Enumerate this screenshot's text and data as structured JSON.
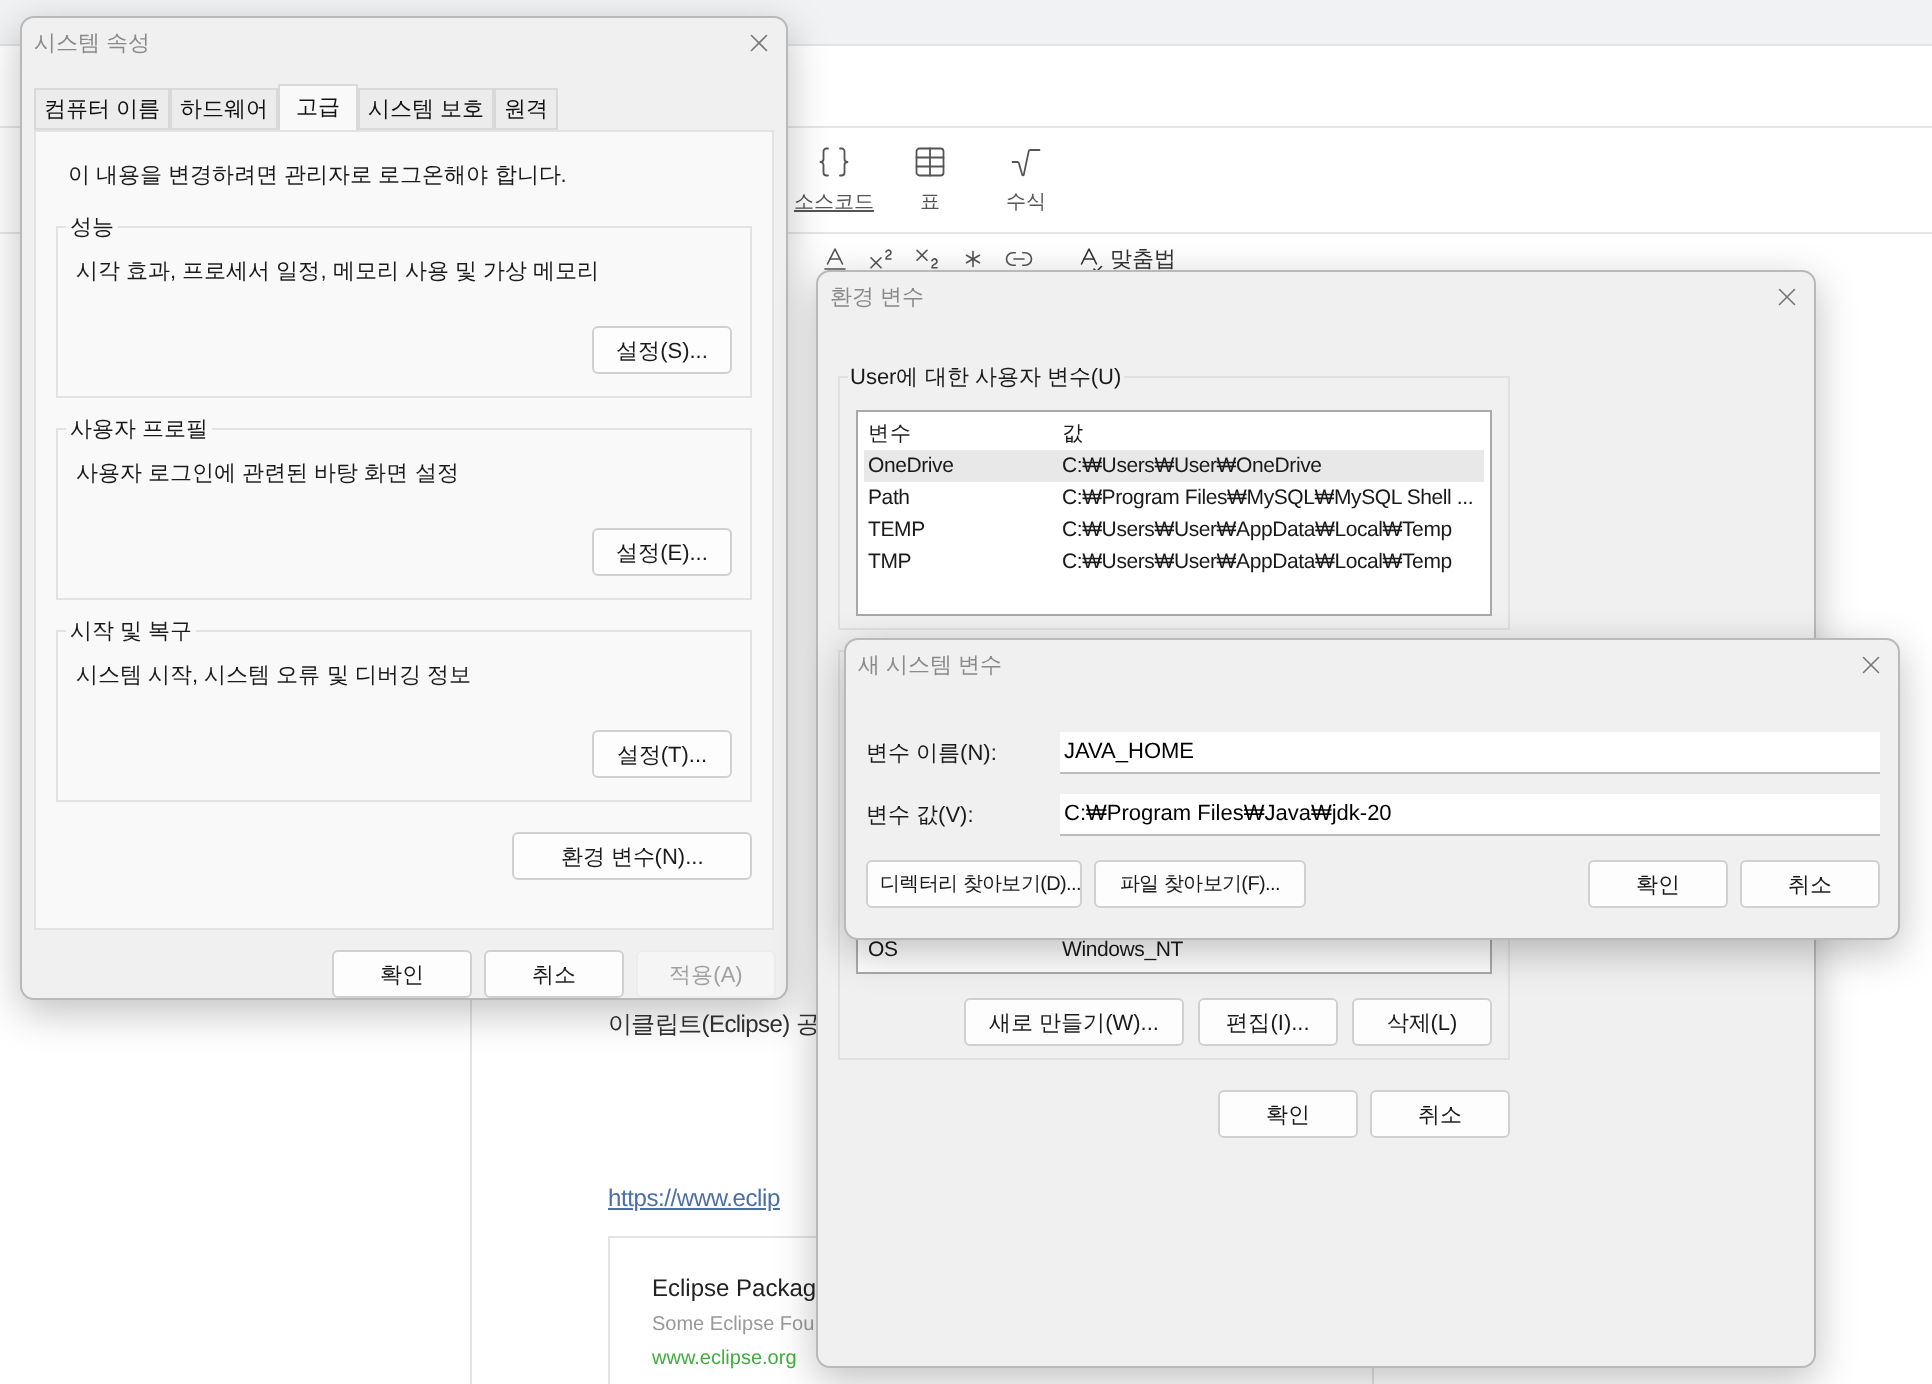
{
  "browser": {
    "insert_tools": [
      {
        "kind": "code",
        "label": "소스코드",
        "underlined": true
      },
      {
        "kind": "table",
        "label": "표",
        "underlined": false
      },
      {
        "kind": "formula",
        "label": "수식",
        "underlined": false
      }
    ],
    "format_tools": [
      {
        "kind": "text-style"
      },
      {
        "kind": "superscript"
      },
      {
        "kind": "subscript"
      },
      {
        "kind": "symbol"
      },
      {
        "kind": "link"
      },
      {
        "kind": "spellcheck",
        "label": "맞춤법"
      }
    ],
    "article": {
      "paragraph": "이클립트(Eclipse) 공",
      "link": "https://www.eclip",
      "card": {
        "title": "Eclipse Packag",
        "description": "Some Eclipse Fou",
        "url": "www.eclipse.org"
      }
    }
  },
  "system_properties": {
    "title": "시스템 속성",
    "tabs": [
      {
        "label": "컴퓨터 이름",
        "selected": false
      },
      {
        "label": "하드웨어",
        "selected": false
      },
      {
        "label": "고급",
        "selected": true
      },
      {
        "label": "시스템 보호",
        "selected": false
      },
      {
        "label": "원격",
        "selected": false
      }
    ],
    "notice": "이 내용을 변경하려면 관리자로 로그온해야 합니다.",
    "sections": [
      {
        "title": "성능",
        "description": "시각 효과, 프로세서 일정, 메모리 사용 및 가상 메모리",
        "button": "설정(S)..."
      },
      {
        "title": "사용자 프로필",
        "description": "사용자 로그인에 관련된 바탕 화면 설정",
        "button": "설정(E)..."
      },
      {
        "title": "시작 및 복구",
        "description": "시스템 시작, 시스템 오류 및 디버깅 정보",
        "button": "설정(T)..."
      }
    ],
    "env_button": "환경 변수(N)...",
    "buttons": [
      {
        "label": "확인",
        "disabled": false
      },
      {
        "label": "취소",
        "disabled": false
      },
      {
        "label": "적용(A)",
        "disabled": true
      }
    ]
  },
  "environment_variables": {
    "title": "환경 변수",
    "user_group": "User에 대한 사용자 변수(U)",
    "columns": [
      "변수",
      "값"
    ],
    "user_rows": [
      {
        "name": "OneDrive",
        "value": "C:₩Users₩User₩OneDrive",
        "selected": true
      },
      {
        "name": "Path",
        "value": "C:₩Program Files₩MySQL₩MySQL Shell ...",
        "selected": false
      },
      {
        "name": "TEMP",
        "value": "C:₩Users₩User₩AppData₩Local₩Temp",
        "selected": false
      },
      {
        "name": "TMP",
        "value": "C:₩Users₩User₩AppData₩Local₩Temp",
        "selected": false
      }
    ],
    "system_rows": [
      {
        "name": "OS",
        "value": "Windows_NT"
      }
    ],
    "group_buttons": [
      "새로 만들기(W)...",
      "편집(I)...",
      "삭제(L)"
    ],
    "buttons": [
      "확인",
      "취소"
    ]
  },
  "new_system_variable": {
    "title": "새 시스템 변수",
    "fields": [
      {
        "label": "변수 이름(N):",
        "value": "JAVA_HOME"
      },
      {
        "label": "변수 값(V):",
        "value": "C:₩Program Files₩Java₩jdk-20"
      }
    ],
    "browse_buttons": [
      "디렉터리 찾아보기(D)...",
      "파일 찾아보기(F)..."
    ],
    "buttons": [
      "확인",
      "취소"
    ]
  }
}
